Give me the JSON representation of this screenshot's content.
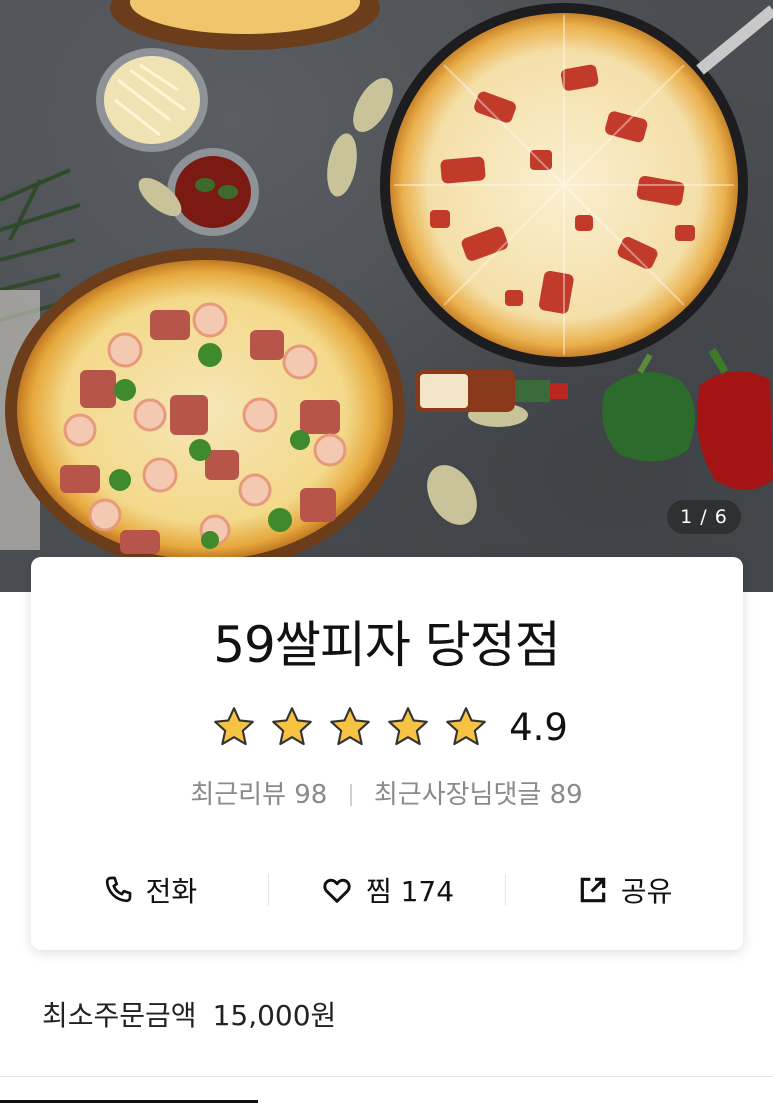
{
  "gallery": {
    "counter": "1 / 6"
  },
  "store": {
    "name": "59쌀피자 당정점",
    "rating": "4.9",
    "stars": 5,
    "recent_review_label": "최근리뷰 98",
    "owner_reply_label": "최근사장님댓글 89"
  },
  "actions": {
    "call_label": "전화",
    "favorite_label": "찜 174",
    "share_label": "공유"
  },
  "order": {
    "min_order_label": "최소주문금액",
    "min_order_value": "15,000원"
  },
  "icons": {
    "call": "phone-icon",
    "favorite": "heart-icon",
    "share": "share-icon",
    "star": "star-icon"
  },
  "colors": {
    "star": "#f6c343",
    "text": "#111111",
    "muted": "#8a8a8a"
  }
}
